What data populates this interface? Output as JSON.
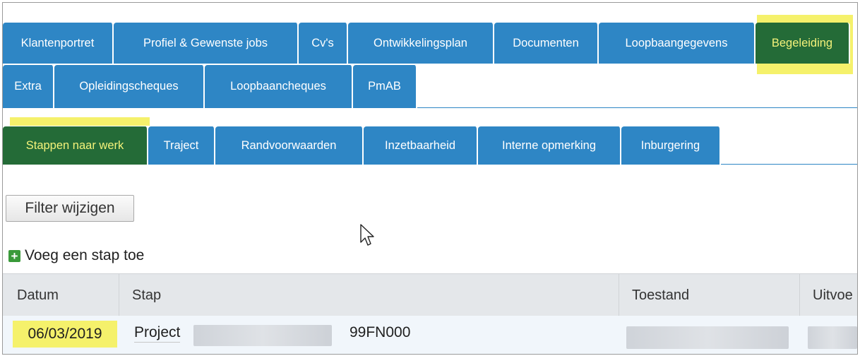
{
  "tabs_row1": [
    "Klantenportret",
    "Profiel & Gewenste jobs",
    "Cv's",
    "Ontwikkelingsplan",
    "Documenten",
    "Loopbaangegevens",
    "Begeleiding"
  ],
  "tabs_row2": [
    "Extra",
    "Opleidingscheques",
    "Loopbaancheques",
    "PmAB"
  ],
  "subtabs": [
    "Stappen naar werk",
    "Traject",
    "Randvoorwaarden",
    "Inzetbaarheid",
    "Interne opmerking",
    "Inburgering"
  ],
  "active_tab": "Begeleiding",
  "active_subtab": "Stappen naar werk",
  "filter_button": "Filter wijzigen",
  "add_step_label": "Voeg een stap toe",
  "table": {
    "headers": [
      "Datum",
      "Stap",
      "Toestand",
      "Uitvoe"
    ],
    "rows": [
      {
        "datum": "06/03/2019",
        "stap": "Project",
        "code": "99FN000"
      }
    ]
  },
  "icons": {
    "add": "plus-icon",
    "pointer": "mouse-cursor-icon"
  },
  "colors": {
    "tab_blue": "#2e86c5",
    "active_tab_bg": "#246b37",
    "active_tab_text": "#f4f27a",
    "highlight": "#f5f16b"
  }
}
